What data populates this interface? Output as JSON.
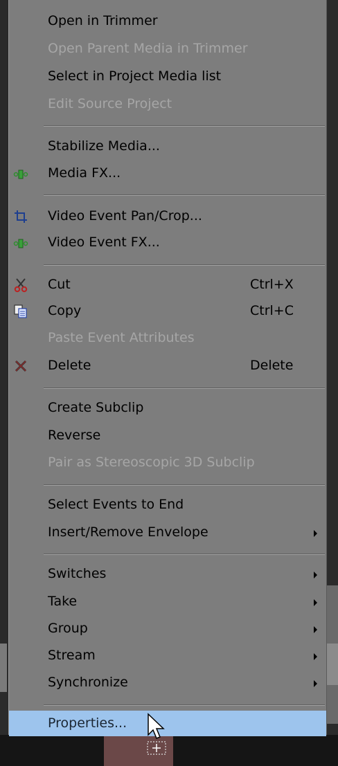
{
  "menu": {
    "items": [
      {
        "label": "Open in Trimmer",
        "disabled": false
      },
      {
        "label": "Open Parent Media in Trimmer",
        "disabled": true
      },
      {
        "label": "Select in Project Media list",
        "disabled": false
      },
      {
        "label": "Edit Source Project",
        "disabled": true
      },
      {
        "label": "Stabilize Media...",
        "disabled": false
      },
      {
        "label": "Media FX...",
        "icon": "fx-plugin-icon",
        "disabled": false
      },
      {
        "label": "Video Event Pan/Crop...",
        "icon": "crop-icon",
        "disabled": false
      },
      {
        "label": "Video Event FX...",
        "icon": "fx-plugin-icon",
        "disabled": false
      },
      {
        "label": "Cut",
        "shortcut": "Ctrl+X",
        "icon": "scissors-icon",
        "disabled": false
      },
      {
        "label": "Copy",
        "shortcut": "Ctrl+C",
        "icon": "copy-icon",
        "disabled": false
      },
      {
        "label": "Paste Event Attributes",
        "disabled": true
      },
      {
        "label": "Delete",
        "shortcut": "Delete",
        "icon": "delete-x-icon",
        "disabled": false
      },
      {
        "label": "Create Subclip",
        "disabled": false
      },
      {
        "label": "Reverse",
        "disabled": false
      },
      {
        "label": "Pair as Stereoscopic 3D Subclip",
        "disabled": true
      },
      {
        "label": "Select Events to End",
        "disabled": false
      },
      {
        "label": "Insert/Remove Envelope",
        "submenu": true,
        "disabled": false
      },
      {
        "label": "Switches",
        "submenu": true,
        "disabled": false
      },
      {
        "label": "Take",
        "submenu": true,
        "disabled": false
      },
      {
        "label": "Group",
        "submenu": true,
        "disabled": false
      },
      {
        "label": "Stream",
        "submenu": true,
        "disabled": false
      },
      {
        "label": "Synchronize",
        "submenu": true,
        "disabled": false
      },
      {
        "label": "Properties...",
        "disabled": false,
        "highlighted": true
      }
    ]
  },
  "colors": {
    "menu_background": "#7d7d7d",
    "highlight": "#9dc4ed",
    "disabled_text": "#a6a6a6"
  }
}
